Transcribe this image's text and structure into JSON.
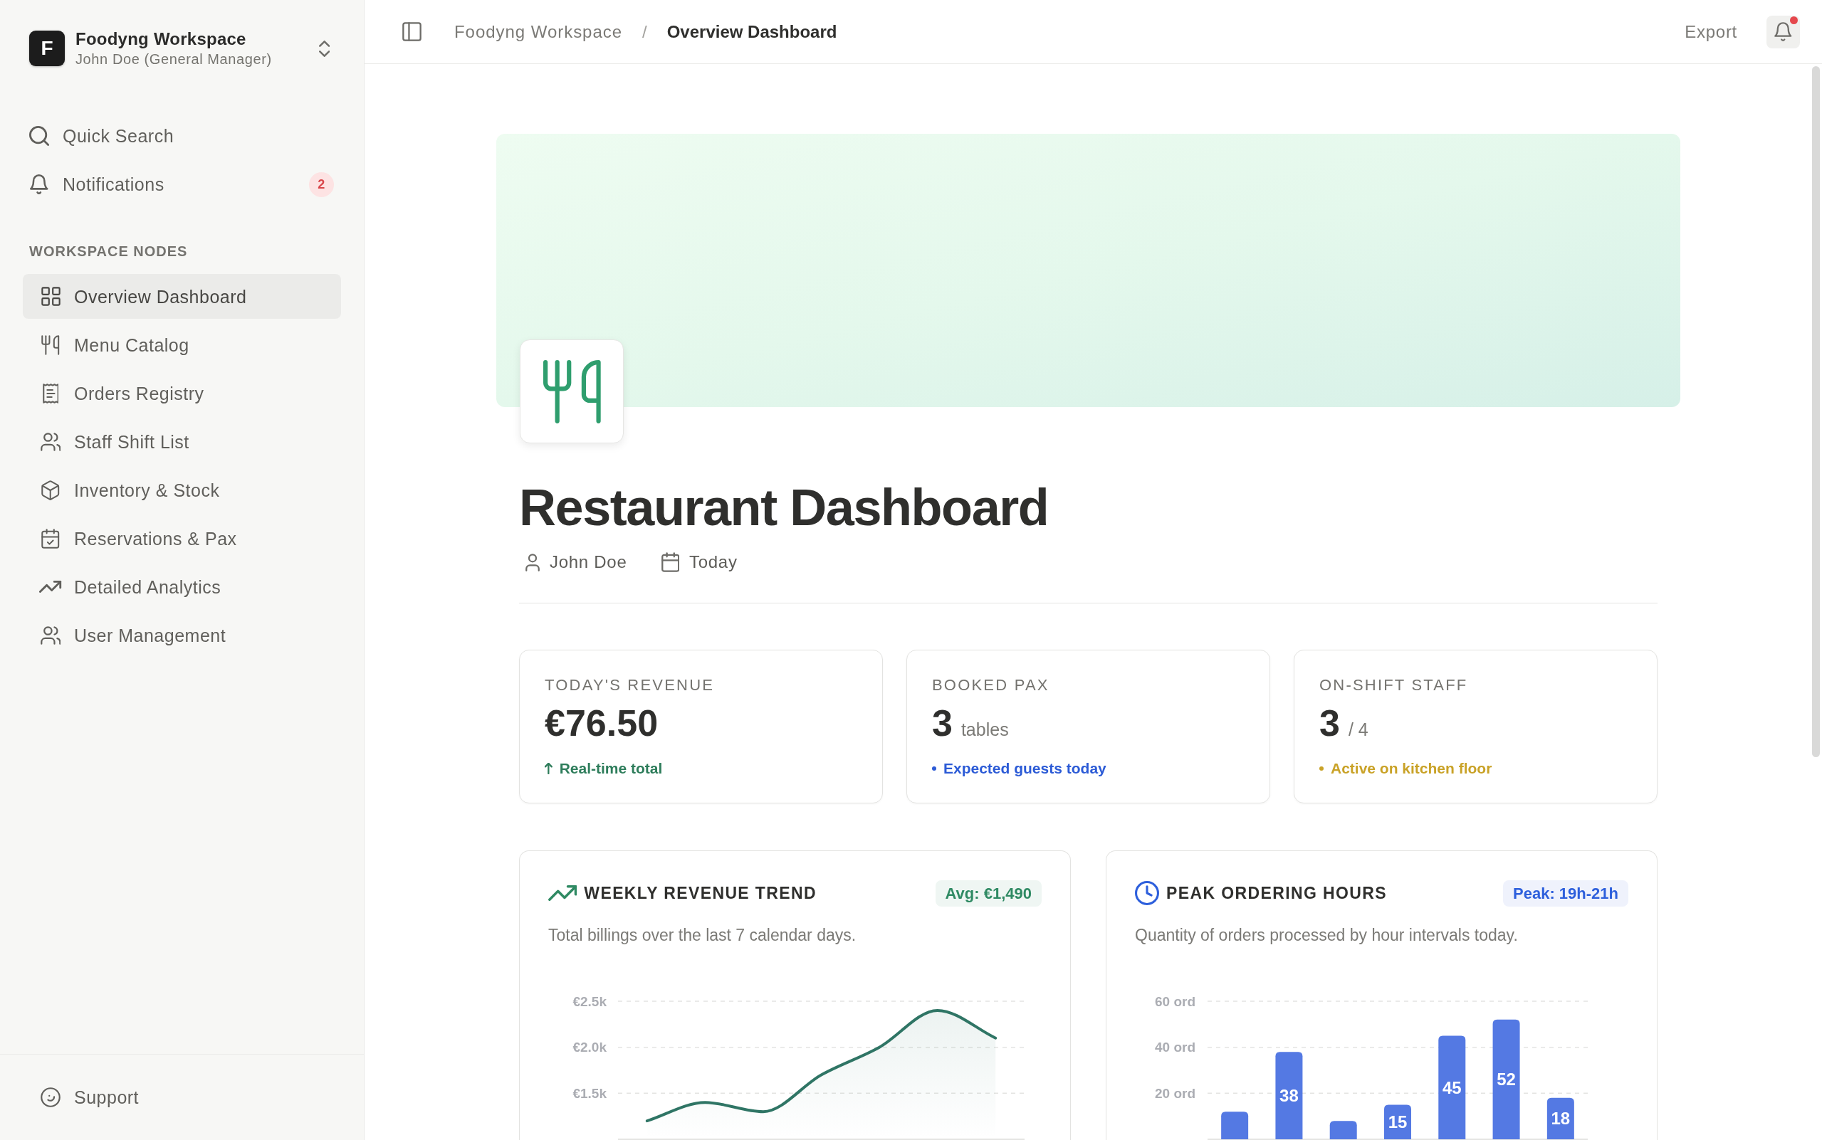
{
  "workspace": {
    "initial": "F",
    "name": "Foodyng Workspace",
    "user": "John Doe (General Manager)"
  },
  "sidebar": {
    "actions": [
      {
        "kind": "search",
        "label": "Quick Search"
      },
      {
        "kind": "notifications",
        "label": "Notifications",
        "badge": "2"
      }
    ],
    "section_title": "WORKSPACE NODES",
    "items": [
      {
        "label": "Overview Dashboard",
        "selected": true
      },
      {
        "label": "Menu Catalog",
        "selected": false
      },
      {
        "label": "Orders Registry",
        "selected": false
      },
      {
        "label": "Staff Shift List",
        "selected": false
      },
      {
        "label": "Inventory & Stock",
        "selected": false
      },
      {
        "label": "Reservations & Pax",
        "selected": false
      },
      {
        "label": "Detailed Analytics",
        "selected": false
      },
      {
        "label": "User Management",
        "selected": false
      }
    ],
    "footer": {
      "label": "Support"
    }
  },
  "topbar": {
    "breadcrumb": [
      {
        "label": "Foodyng Workspace",
        "current": false
      },
      {
        "label": "Overview Dashboard",
        "current": true
      }
    ],
    "separator": "/",
    "export": "Export",
    "unread_notifications": true
  },
  "page": {
    "title": "Restaurant Dashboard",
    "meta": [
      {
        "kind": "person",
        "label": "John Doe"
      },
      {
        "kind": "date",
        "label": "Today"
      }
    ]
  },
  "stats": [
    {
      "label": "TODAY'S REVENUE",
      "value": "€76.50",
      "kind": "trend",
      "note": "Real-time total",
      "color": "#2e7d5b"
    },
    {
      "label": "BOOKED PAX",
      "value": "3",
      "unit": "tables",
      "kind": "status",
      "note": "Expected guests today",
      "color": "#2c5bd6"
    },
    {
      "label": "ON-SHIFT STAFF",
      "value": "3",
      "unit": "/ 4",
      "kind": "status",
      "note": "Active on kitchen floor",
      "color": "#c9a227"
    }
  ],
  "charts": [
    {
      "title": "WEEKLY REVENUE TREND",
      "badge": "Avg: €1,490",
      "subtitle": "Total billings over the last 7 calendar days.",
      "color": "#2f8a63",
      "chart_data": {
        "type": "area",
        "series": [
          {
            "color": "#2f7565",
            "values": [
              1200,
              1400,
              1300,
              1700,
              2000,
              2400,
              2100
            ]
          }
        ],
        "ylim": [
          1000,
          2500
        ],
        "yticks": [
          {
            "value": 1500,
            "label": "€1.5k"
          },
          {
            "value": 2000,
            "label": "€2.0k"
          },
          {
            "value": 2500,
            "label": "€2.5k"
          }
        ],
        "grid": true
      }
    },
    {
      "title": "PEAK ORDERING HOURS",
      "badge": "Peak: 19h-21h",
      "subtitle": "Quantity of orders processed by hour intervals today.",
      "color": "#2d5fdc",
      "chart_data": {
        "type": "bar",
        "series": [
          {
            "color": "#5479e3",
            "values": [
              12,
              38,
              8,
              15,
              45,
              52,
              18
            ]
          }
        ],
        "ylim": [
          0,
          60
        ],
        "yticks": [
          {
            "value": 20,
            "label": "20 ord"
          },
          {
            "value": 40,
            "label": "40 ord"
          },
          {
            "value": 60,
            "label": "60 ord"
          }
        ],
        "grid": true,
        "value_labels": [
          null,
          "38",
          null,
          "15",
          "45",
          "52",
          "18"
        ]
      }
    }
  ]
}
